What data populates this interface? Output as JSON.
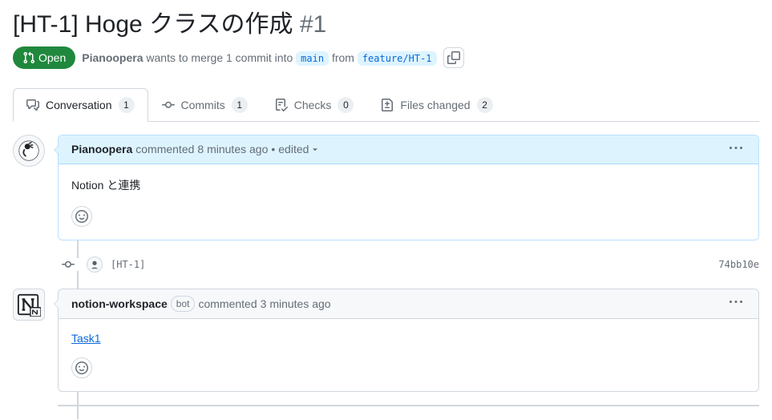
{
  "header": {
    "title": "[HT-1] Hoge クラスの作成",
    "issue_number": "#1",
    "state": "Open",
    "author": "Pianoopera",
    "merge_text_1": "wants to merge 1 commit into",
    "base_branch": "main",
    "merge_text_2": "from",
    "head_branch": "feature/HT-1"
  },
  "tabs": {
    "conversation": {
      "label": "Conversation",
      "count": "1"
    },
    "commits": {
      "label": "Commits",
      "count": "1"
    },
    "checks": {
      "label": "Checks",
      "count": "0"
    },
    "files": {
      "label": "Files changed",
      "count": "2"
    }
  },
  "comments": [
    {
      "author": "Pianoopera",
      "action": "commented",
      "time": "8 minutes ago",
      "edited": "edited",
      "body": "Notion と連携",
      "bot": false,
      "is_author": true
    },
    {
      "author": "notion-workspace",
      "action": "commented",
      "time": "3 minutes ago",
      "body_link": "Task1",
      "bot": true,
      "bot_label": "bot",
      "is_author": false
    }
  ],
  "commit": {
    "message": "[HT-1]",
    "sha": "74bb10e"
  },
  "edited_dot": "•"
}
